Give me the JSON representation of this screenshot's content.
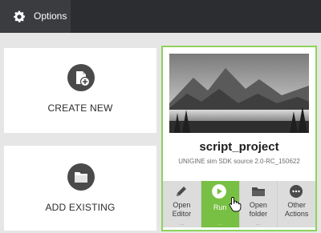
{
  "topbar": {
    "options_label": "Options",
    "options_icon": "gear-icon"
  },
  "cards": {
    "create_new": {
      "label": "CREATE NEW",
      "icon": "new-file-icon"
    },
    "add_existing": {
      "label": "ADD EXISTING",
      "icon": "folder-icon"
    }
  },
  "project": {
    "title": "script_project",
    "subtitle": "UNIGINE sim SDK source 2.0-RC_150622",
    "thumbnail_icon": "mountain-landscape-thumbnail",
    "actions": [
      {
        "label": "Open\nEditor",
        "icon": "pencil-icon",
        "more": "..."
      },
      {
        "label": "Run",
        "icon": "play-icon",
        "more": "..."
      },
      {
        "label": "Open\nfolder",
        "icon": "folder-icon",
        "more": "..."
      },
      {
        "label": "Other\nActions",
        "icon": "more-icon",
        "more": ""
      }
    ]
  },
  "colors": {
    "accent": "#78c043",
    "selection_border": "#8fd25a",
    "topbar": "#2b2d30"
  }
}
